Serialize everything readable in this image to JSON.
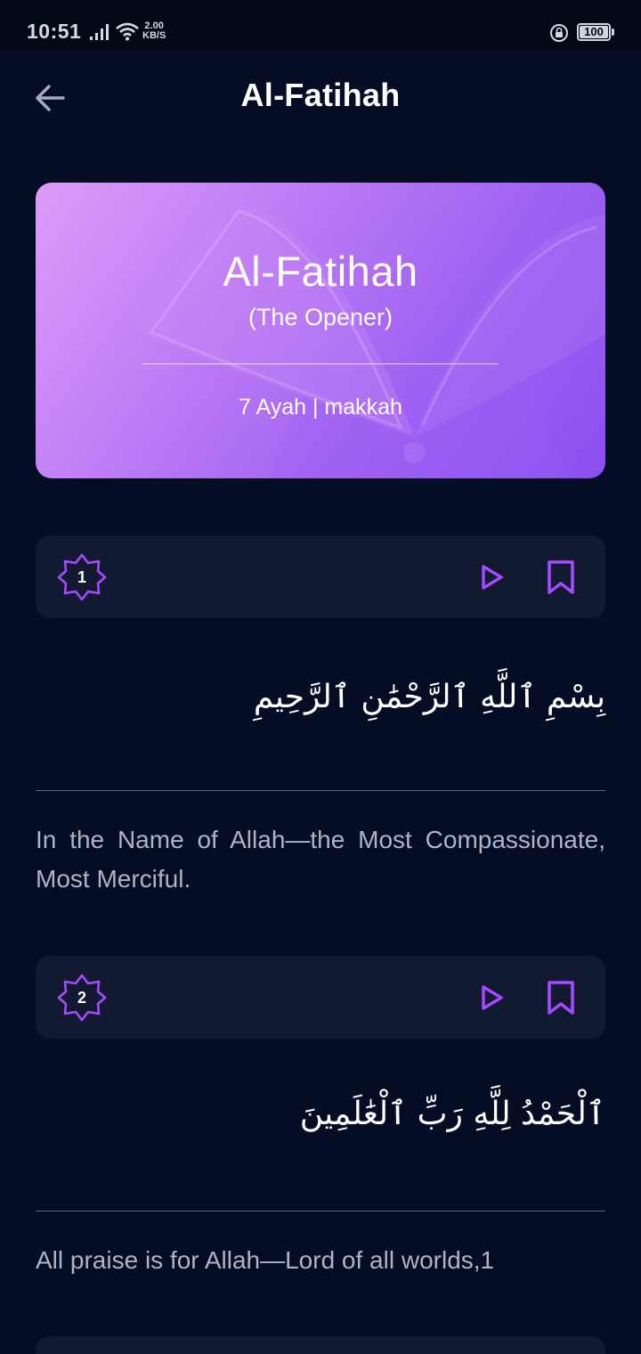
{
  "status_bar": {
    "time": "10:51",
    "net_speed_value": "2.00",
    "net_speed_unit": "KB/S",
    "battery": "100",
    "icons": [
      "signal-icon",
      "wifi-icon",
      "rotation-lock-icon",
      "battery-icon"
    ]
  },
  "header": {
    "title": "Al-Fatihah",
    "back_icon": "arrow-left-icon"
  },
  "surah_card": {
    "name": "Al-Fatihah",
    "meaning": "(The Opener)",
    "info": "7 Ayah | makkah",
    "background_icon": "open-quran-icon"
  },
  "ayahs": [
    {
      "number": "1",
      "arabic": "بِسْمِ ٱللَّهِ ٱلرَّحْمَٰنِ ٱلرَّحِيمِ",
      "translation": "In the Name of Allah—the Most Compassionate, Most Merciful."
    },
    {
      "number": "2",
      "arabic": "ٱلْحَمْدُ لِلَّهِ رَبِّ ٱلْعَٰلَمِينَ",
      "translation": "All praise is for Allah—Lord of all worlds,1"
    }
  ],
  "colors": {
    "background": "#050d24",
    "card_bar": "#121a31",
    "accent": "#a44aff",
    "translation_text": "#aeb3c6",
    "banner_gradient_start": "#dd9cf8",
    "banner_gradient_end": "#8c4ff0"
  }
}
